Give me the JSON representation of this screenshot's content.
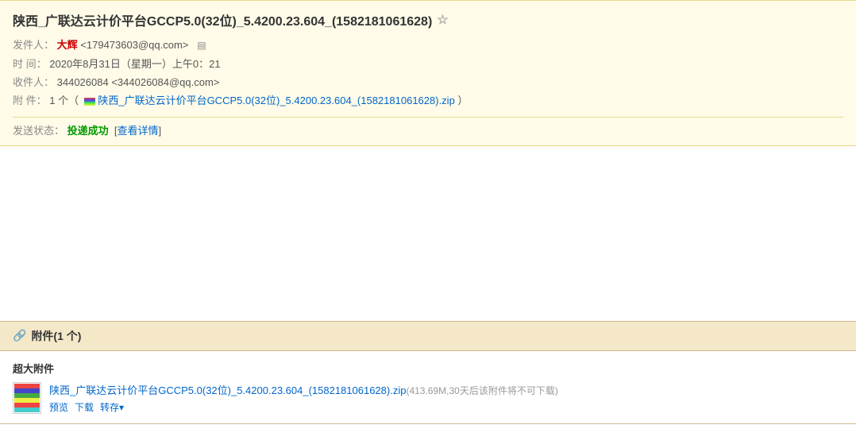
{
  "email": {
    "subject": "陕西_广联达云计价平台GCCP5.0(32位)_5.4200.23.604_(1582181061628)",
    "star_icon": "☆",
    "sender_label": "发件人：",
    "sender_name": "大辉",
    "sender_email": "<179473603@qq.com>",
    "time_label": "时  间：",
    "time_value": "2020年8月31日（星期一）上午0：21",
    "recipient_label": "收件人：",
    "recipient_value": "344026084 <344026084@qq.com>",
    "attachment_label": "附  件：",
    "attachment_count": "1 个（",
    "attachment_filename_inline": "陕西_广联达云计价平台GCCP5.0(32位)_5.4200.23.604_(1582181061628).zip",
    "attachment_close_paren": "）",
    "status_label": "发送状态：",
    "status_value": "投递成功",
    "status_detail": "查看详情",
    "attachment_section_title": "附件(1 个)",
    "super_attachment_label": "超大附件",
    "attachment_file_name": "陕西_广联达云计价平台GCCP5.0(32位)_5.4200.23.604_(1582181061628).zip",
    "attachment_file_meta": "(413.69M,30天后该附件将不可下载)",
    "action_preview": "预览",
    "action_download": "下载",
    "action_save": "转存",
    "action_save_arrow": "▾"
  }
}
